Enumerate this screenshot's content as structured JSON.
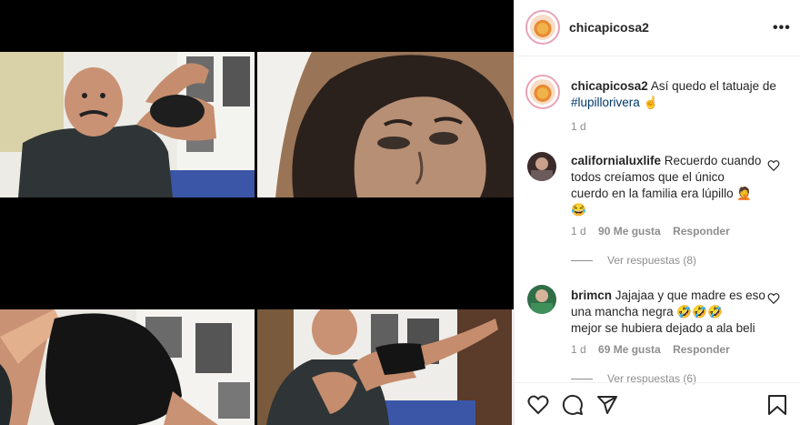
{
  "post": {
    "username": "chicapicosa2",
    "more_label": "•••"
  },
  "caption": {
    "username": "chicapicosa2",
    "text": "Así quedo el tatuaje de",
    "hashtag": "#lupillorivera",
    "emoji": "☝",
    "time": "1 d"
  },
  "comments": [
    {
      "username": "californialuxlife",
      "line1": "Recuerdo cuando",
      "line2": "todos creíamos que el único",
      "line3": "cuerdo en la familia era lúpillo",
      "emoji_end": "🤦",
      "emoji_line": "😂",
      "time": "1 d",
      "likes": "90 Me gusta",
      "reply": "Responder",
      "view_replies": "Ver respuestas (8)"
    },
    {
      "username": "brimcn",
      "line1": "Jajajaa y que madre es eso",
      "line2": "una mancha negra",
      "emojis": "🤣🤣🤣",
      "line3": "mejor se hubiera dejado a ala beli",
      "time": "1 d",
      "likes": "69 Me gusta",
      "reply": "Responder",
      "view_replies": "Ver respuestas (6)"
    }
  ],
  "icons": {
    "like": "heart-icon",
    "comment": "comment-icon",
    "share": "share-icon",
    "save": "bookmark-icon"
  },
  "colors": {
    "text": "#262626",
    "muted": "#8e8e8e",
    "link": "#00376b",
    "border": "#efefef"
  }
}
